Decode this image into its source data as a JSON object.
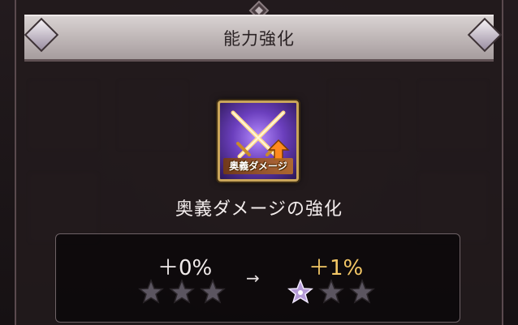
{
  "header": {
    "title": "能力強化"
  },
  "skill": {
    "icon_name": "crossed-swords-icon",
    "icon_label": "奥義ダメージ",
    "name": "奥義ダメージの強化"
  },
  "upgrade": {
    "current_value": "＋0%",
    "next_value": "＋1%",
    "arrow": "→",
    "current_stars_filled": 0,
    "next_stars_filled": 1,
    "stars_total": 3
  },
  "colors": {
    "accent_gold": "#f3c766",
    "text_light": "#f0eaea",
    "star_filled": "#b49ad8",
    "star_empty": "#5b5560"
  }
}
